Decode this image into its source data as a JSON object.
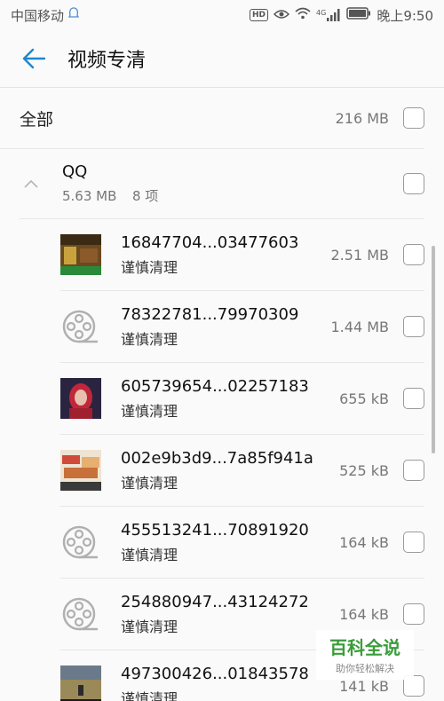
{
  "status": {
    "carrier": "中国移动",
    "time": "晚上9:50",
    "hd": "HD",
    "net": "4G"
  },
  "header": {
    "title": "视频专清"
  },
  "all": {
    "label": "全部",
    "size": "216 MB"
  },
  "group": {
    "name": "QQ",
    "size": "5.63 MB",
    "count": "8 项"
  },
  "files": [
    {
      "name": "16847704...03477603",
      "sub": "谨慎清理",
      "size": "2.51 MB",
      "thumb": "photo-shop"
    },
    {
      "name": "78322781...79970309",
      "sub": "谨慎清理",
      "size": "1.44 MB",
      "thumb": "film-reel-icon"
    },
    {
      "name": "605739654...02257183",
      "sub": "谨慎清理",
      "size": "655 kB",
      "thumb": "photo-person"
    },
    {
      "name": "002e9b3d9...7a85f941a",
      "sub": "谨慎清理",
      "size": "525 kB",
      "thumb": "photo-food"
    },
    {
      "name": "455513241...70891920",
      "sub": "谨慎清理",
      "size": "164 kB",
      "thumb": "film-reel-icon"
    },
    {
      "name": "254880947...43124272",
      "sub": "谨慎清理",
      "size": "164 kB",
      "thumb": "film-reel-icon"
    },
    {
      "name": "497300426...01843578",
      "sub": "谨慎清理",
      "size": "141 kB",
      "thumb": "photo-game"
    }
  ],
  "watermark": {
    "main": "百科全说",
    "sub": "助你轻松解决"
  },
  "colors": {
    "accent": "#1e88c9",
    "watermark": "#3a9c3a"
  }
}
